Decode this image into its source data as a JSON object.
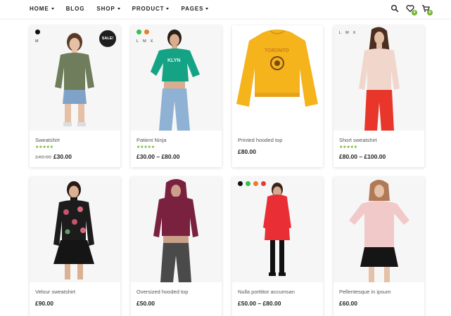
{
  "nav": [
    {
      "label": "HOME",
      "has_caret": true
    },
    {
      "label": "BLOG",
      "has_caret": false
    },
    {
      "label": "SHOP",
      "has_caret": true
    },
    {
      "label": "PRODUCT",
      "has_caret": true
    },
    {
      "label": "PAGES",
      "has_caret": true
    }
  ],
  "header_icons": {
    "search": "search-icon",
    "wishlist": {
      "icon": "heart-icon",
      "count": "0"
    },
    "cart": {
      "icon": "cart-icon",
      "count": "0"
    }
  },
  "accent_color": "#6fb32c",
  "products": [
    {
      "name": "Sweatshirt",
      "old_price": "£40.00",
      "price": "£30.00",
      "rating": "★★★★★",
      "sale_label": "SALE!",
      "swatches": [
        "#111111"
      ],
      "sizes": [
        "M"
      ]
    },
    {
      "name": "Patient Ninja",
      "old_price": "",
      "price": "£30.00 – £80.00",
      "rating": "★★★★★",
      "sale_label": "",
      "swatches": [
        "#33c24a",
        "#ee7a2e"
      ],
      "sizes": [
        "L",
        "M",
        "X"
      ]
    },
    {
      "name": "Printed hooded top",
      "old_price": "",
      "price": "£80.00",
      "rating": "",
      "sale_label": "",
      "swatches": [],
      "sizes": []
    },
    {
      "name": "Short sweatshirt",
      "old_price": "",
      "price": "£80.00 – £100.00",
      "rating": "★★★★★",
      "sale_label": "",
      "swatches": [],
      "sizes": [
        "L",
        "M",
        "X"
      ]
    },
    {
      "name": "Velour sweatshirt",
      "old_price": "",
      "price": "£90.00",
      "rating": "",
      "sale_label": "",
      "swatches": [],
      "sizes": []
    },
    {
      "name": "Oversized hooded top",
      "old_price": "",
      "price": "£50.00",
      "rating": "",
      "sale_label": "",
      "swatches": [],
      "sizes": []
    },
    {
      "name": "Nulla porttitor accumsan",
      "old_price": "",
      "price": "£50.00 – £80.00",
      "rating": "",
      "sale_label": "",
      "swatches": [
        "#111111",
        "#33c24a",
        "#ee7a2e",
        "#e43b3b"
      ],
      "sizes": []
    },
    {
      "name": "Pellentesque in ipsum",
      "old_price": "",
      "price": "£60.00",
      "rating": "",
      "sale_label": "",
      "swatches": [],
      "sizes": []
    }
  ]
}
